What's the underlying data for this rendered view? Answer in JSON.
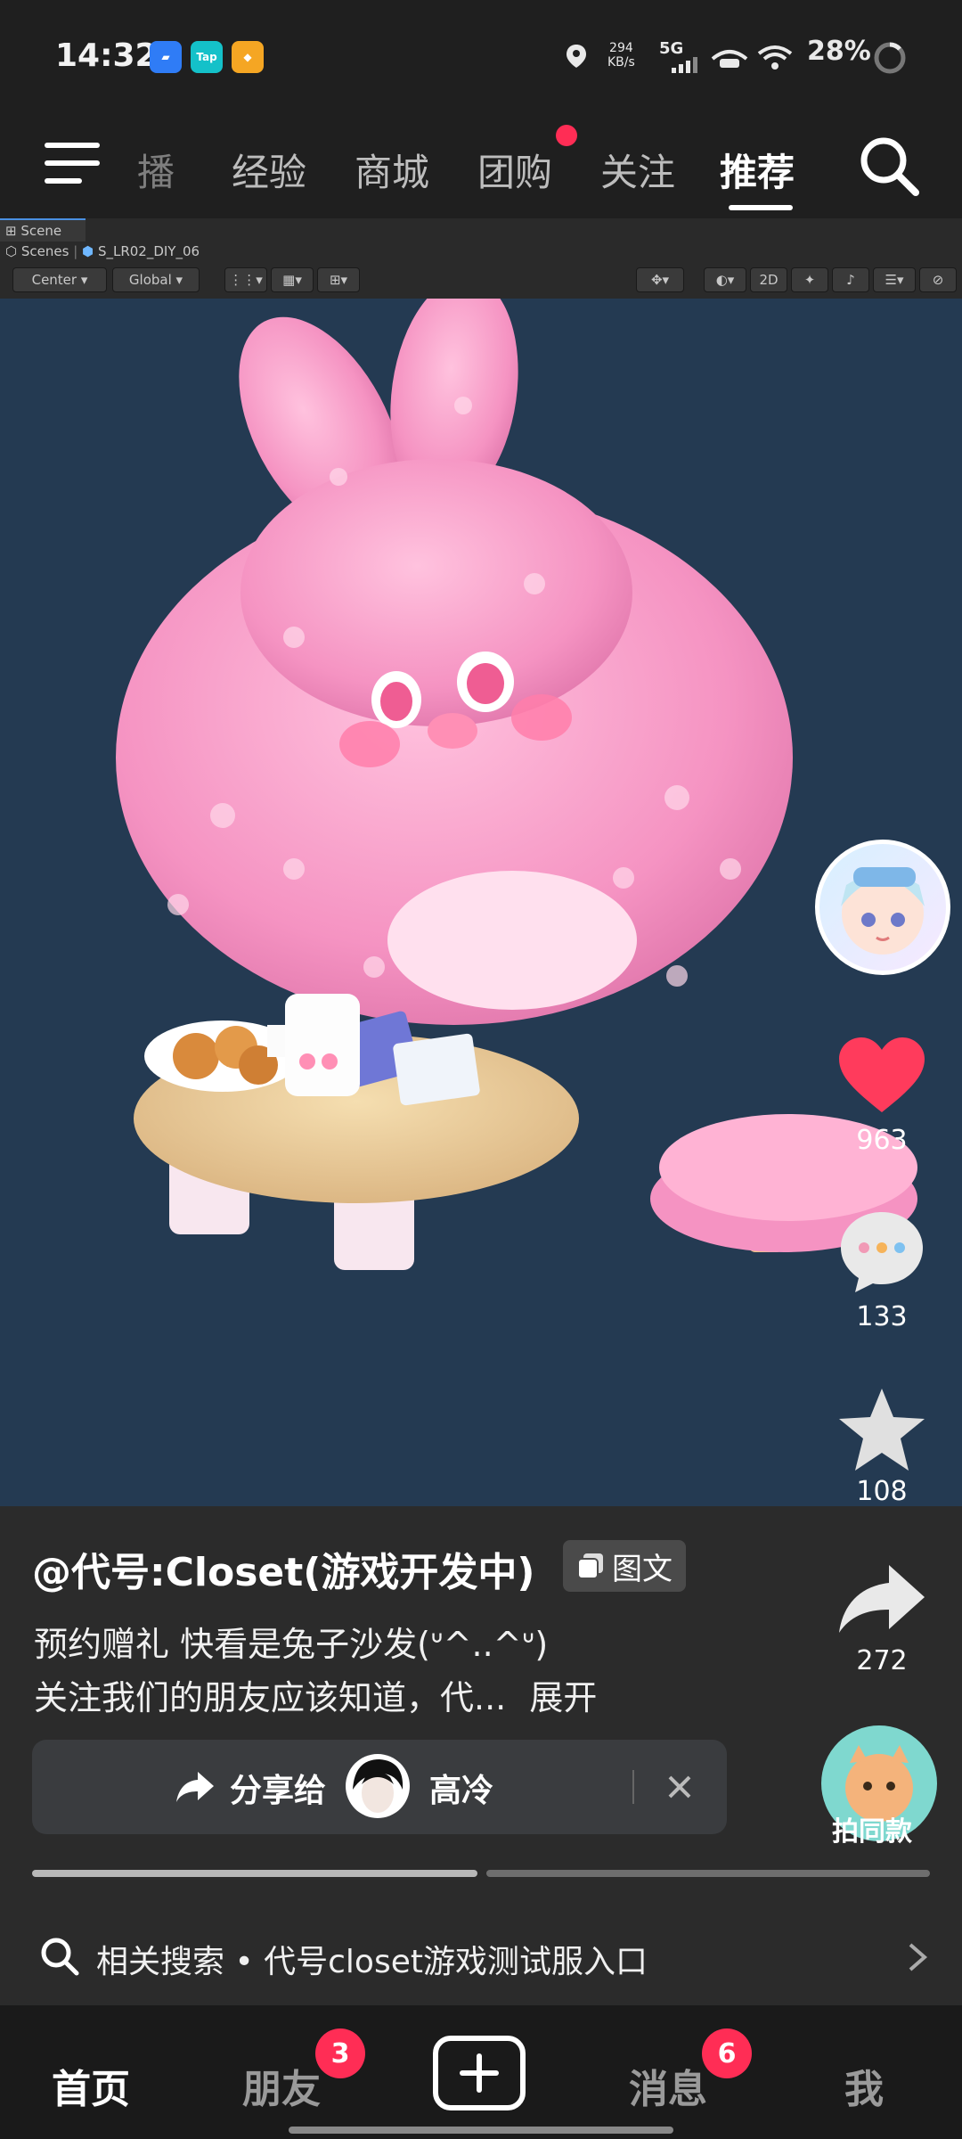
{
  "status_bar": {
    "time": "14:32",
    "net_speed_value": "294",
    "net_speed_unit": "KB/s",
    "network": "5G",
    "battery": "28%",
    "app_icons": [
      "Tap"
    ]
  },
  "top_nav": {
    "tabs": [
      {
        "label": "播"
      },
      {
        "label": "经验"
      },
      {
        "label": "商城"
      },
      {
        "label": "团购"
      },
      {
        "label": "关注"
      },
      {
        "label": "推荐"
      }
    ]
  },
  "unity": {
    "tab": "Scene",
    "breadcrumb_root": "Scenes",
    "breadcrumb_scene": "S_LR02_DIY_06",
    "pivot": "Center",
    "space": "Global",
    "mode_2d": "2D"
  },
  "actions": {
    "likes": "963",
    "comments": "133",
    "favorites": "108",
    "shares": "272",
    "same_style": "拍同款"
  },
  "post": {
    "author": "@代号:Closet(游戏开发中)",
    "tag": "图文",
    "line1": "预约赠礼 快看是兔子沙发(ᐡ^..^ᐡ)",
    "line2": "关注我们的朋友应该知道，代...",
    "expand": "展开"
  },
  "share": {
    "label": "分享给",
    "friend": "高冷"
  },
  "related": {
    "text": "相关搜索 • 代号closet游戏测试服入口"
  },
  "bottom_nav": {
    "home": "首页",
    "friends": "朋友",
    "friends_badge": "3",
    "messages": "消息",
    "messages_badge": "6",
    "me": "我"
  },
  "colors": {
    "accent_red": "#ff2d55",
    "scene_bg": "#243a52",
    "sofa_pink": "#f7a3c9"
  }
}
